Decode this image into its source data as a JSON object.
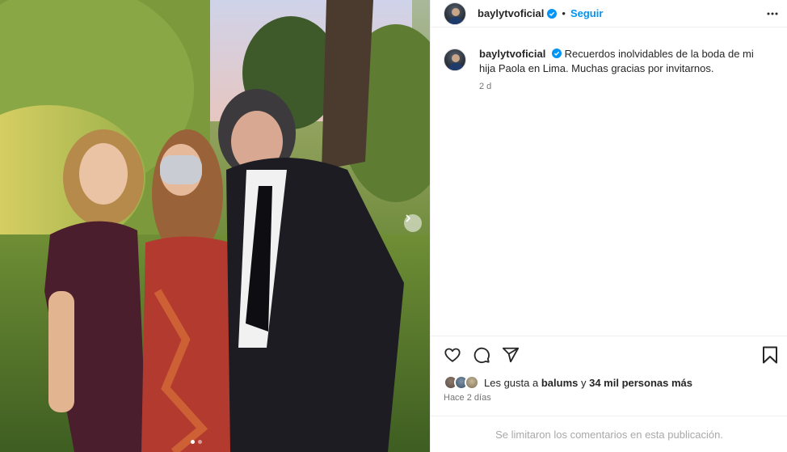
{
  "post": {
    "username": "baylytvoficial",
    "follow_label": "Seguir",
    "separator": "•",
    "caption": "Recuerdos inolvidables de la boda de mi hija Paola en Lima. Muchas gracias por invitarnos.",
    "caption_time": "2 d",
    "likes_prefix": "Les gusta a",
    "liked_by": "balums",
    "likes_mid": "y",
    "likes_count": "34 mil personas más",
    "posted": "Hace 2 días",
    "comments_disabled": "Se limitaron los comentarios en esta publicación."
  },
  "carousel": {
    "slides": 2,
    "active": 1
  },
  "icons": {
    "verified": "verified-badge-icon",
    "more": "more-options-icon",
    "like": "heart-icon",
    "comment": "comment-icon",
    "share": "share-icon",
    "save": "bookmark-icon",
    "next": "chevron-right-icon"
  },
  "colors": {
    "link": "#0095f6",
    "verified": "#0095f6",
    "muted": "#737373",
    "text": "#262626"
  }
}
